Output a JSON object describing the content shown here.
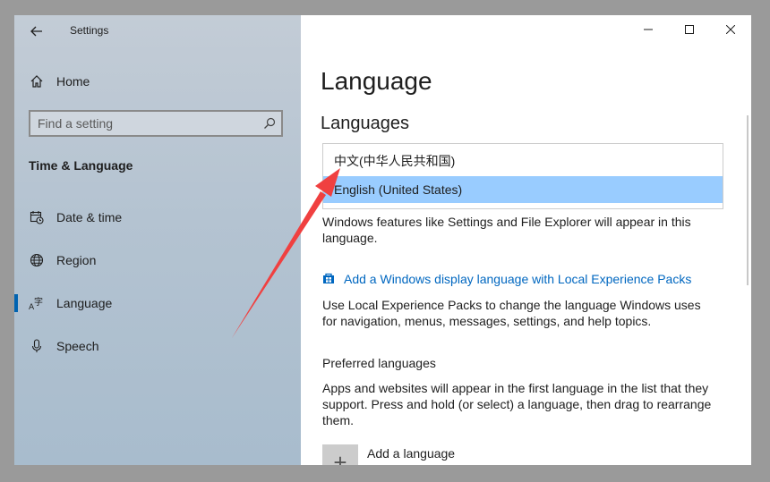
{
  "app": {
    "title": "Settings"
  },
  "window_controls": {
    "minimize_icon": "minimize-icon",
    "maximize_icon": "maximize-icon",
    "close_icon": "close-icon"
  },
  "sidebar": {
    "home": {
      "label": "Home",
      "icon": "home-icon"
    },
    "search": {
      "placeholder": "Find a setting",
      "value": ""
    },
    "section": "Time & Language",
    "items": [
      {
        "label": "Date & time",
        "icon": "calendar-clock-icon",
        "selected": false
      },
      {
        "label": "Region",
        "icon": "globe-icon",
        "selected": false
      },
      {
        "label": "Language",
        "icon": "language-icon",
        "selected": true
      },
      {
        "label": "Speech",
        "icon": "microphone-icon",
        "selected": false
      }
    ]
  },
  "main": {
    "title": "Language",
    "languages_heading": "Languages",
    "display_languages": [
      {
        "label": "中文(中华人民共和国)",
        "selected": false
      },
      {
        "label": "English (United States)",
        "selected": true
      }
    ],
    "display_desc": "Windows features like Settings and File Explorer will appear in this language.",
    "lxp_link": "Add a Windows display language with Local Experience Packs",
    "lxp_desc": "Use Local Experience Packs to change the language Windows uses for navigation, menus, messages, settings, and help topics.",
    "preferred_heading": "Preferred languages",
    "preferred_desc": "Apps and websites will appear in the first language in the list that they support. Press and hold (or select) a language, then drag to rearrange them.",
    "add_language": "Add a language"
  },
  "colors": {
    "accent": "#0063b1",
    "link": "#0067c0",
    "selection": "#99ccff",
    "annotation": "#f04040"
  }
}
